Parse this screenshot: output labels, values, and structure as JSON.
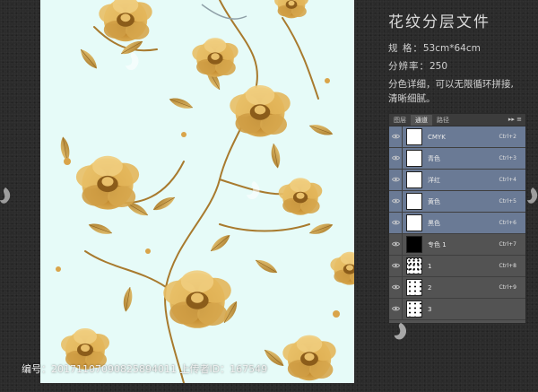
{
  "title": "花纹分层文件",
  "specs": {
    "size_label": "规    格：",
    "size_value": "53cm*64cm",
    "dpi_label": "分辨率：",
    "dpi_value": "250",
    "desc_line1": "分色详细，可以无限循环拼接,",
    "desc_line2": "清晰细腻。"
  },
  "panel": {
    "tabs": [
      "图层",
      "通道",
      "路径"
    ],
    "active_tab": 1,
    "menu_glyph": "▸▸ ≡",
    "channels": [
      {
        "name": "CMYK",
        "shortcut": "Ctrl+2",
        "thumb": "white",
        "selected": true
      },
      {
        "name": "青色",
        "shortcut": "Ctrl+3",
        "thumb": "white",
        "selected": true
      },
      {
        "name": "洋红",
        "shortcut": "Ctrl+4",
        "thumb": "white",
        "selected": true
      },
      {
        "name": "黄色",
        "shortcut": "Ctrl+5",
        "thumb": "white",
        "selected": true
      },
      {
        "name": "黑色",
        "shortcut": "Ctrl+6",
        "thumb": "white",
        "selected": true
      },
      {
        "name": "专色 1",
        "shortcut": "Ctrl+7",
        "thumb": "black",
        "selected": false
      },
      {
        "name": "1",
        "shortcut": "Ctrl+8",
        "thumb": "speck",
        "selected": false
      },
      {
        "name": "2",
        "shortcut": "Ctrl+9",
        "thumb": "speck2",
        "selected": false
      },
      {
        "name": "3",
        "shortcut": "",
        "thumb": "speck2",
        "selected": false
      }
    ]
  },
  "footer": {
    "text": "编号：20171107090825894011 上传者ID：167549"
  },
  "colors": {
    "canvas_bg": "#e6fbf8",
    "flower": "#d9a44a",
    "flower_dark": "#9a6a22",
    "leaf": "#caa050",
    "panel_bg": "#535353",
    "selected_row": "#6a7a95"
  },
  "icons": {
    "eye": "eye-icon",
    "watermark": "leaf-logo-icon"
  }
}
